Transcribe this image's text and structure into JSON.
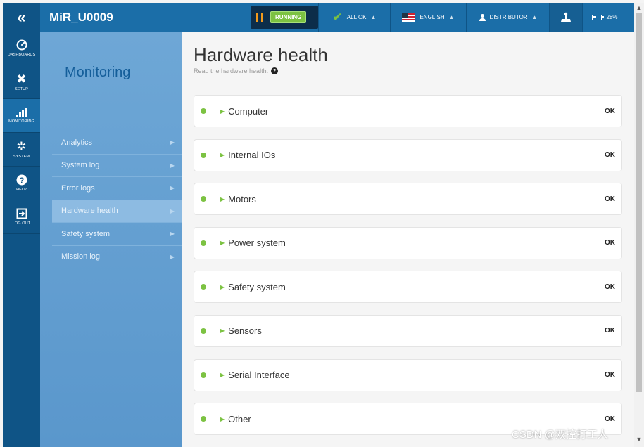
{
  "topbar": {
    "collapse_glyph": "«",
    "robot_name": "MiR_U0009",
    "status_label": "RUNNING",
    "status_icon": "pause-icon",
    "health_label": "ALL OK",
    "language_label": "ENGLISH",
    "user_label": "DISTRIBUTOR",
    "joystick_icon": "joystick-icon",
    "battery_label": "28%",
    "caret": "▲"
  },
  "nav": [
    {
      "label": "DASHBOARDS",
      "icon": "speedometer-icon"
    },
    {
      "label": "SETUP",
      "icon": "tools-icon"
    },
    {
      "label": "MONITORING",
      "icon": "bar-chart-icon"
    },
    {
      "label": "SYSTEM",
      "icon": "gear-icon"
    },
    {
      "label": "HELP",
      "icon": "question-icon"
    },
    {
      "label": "LOG OUT",
      "icon": "logout-icon"
    }
  ],
  "submenu": {
    "title": "Monitoring",
    "items": [
      {
        "label": "Analytics"
      },
      {
        "label": "System log"
      },
      {
        "label": "Error logs"
      },
      {
        "label": "Hardware health",
        "active": true
      },
      {
        "label": "Safety system"
      },
      {
        "label": "Mission log"
      }
    ]
  },
  "main": {
    "title": "Hardware health",
    "subtitle": "Read the hardware health.",
    "help_glyph": "?",
    "items": [
      {
        "name": "Computer",
        "status": "OK"
      },
      {
        "name": "Internal IOs",
        "status": "OK"
      },
      {
        "name": "Motors",
        "status": "OK"
      },
      {
        "name": "Power system",
        "status": "OK"
      },
      {
        "name": "Safety system",
        "status": "OK"
      },
      {
        "name": "Sensors",
        "status": "OK"
      },
      {
        "name": "Serial Interface",
        "status": "OK"
      },
      {
        "name": "Other",
        "status": "OK"
      }
    ]
  },
  "watermark": "CSDN @双控打工人",
  "colors": {
    "accent": "#1b6ea8",
    "ok_green": "#7cc242",
    "nav_dark": "#0f5486"
  }
}
